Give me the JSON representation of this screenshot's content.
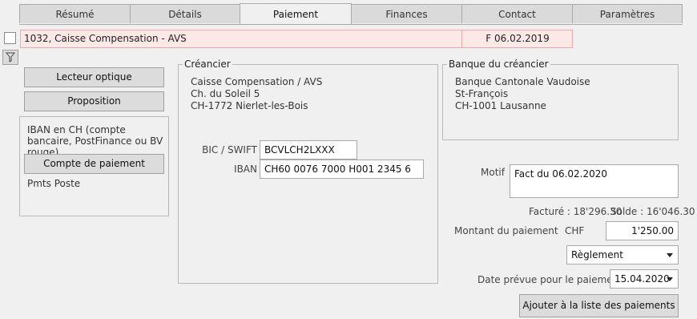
{
  "tabs": [
    "Résumé",
    "Détails",
    "Paiement",
    "Finances",
    "Contact",
    "Paramètres"
  ],
  "active_tab": "Paiement",
  "record": {
    "name": "1032, Caisse Compensation - AVS",
    "invoice": "F 06.02.2019"
  },
  "left": {
    "scanner_label": "Lecteur optique",
    "proposal_label": "Proposition",
    "account_type_text": "IBAN en CH (compte bancaire, PostFinance ou BV rouge)",
    "payment_account_label": "Compte de paiement",
    "pmts_text": "Pmts Poste"
  },
  "creditor": {
    "title": "Créancier",
    "address": [
      "Caisse Compensation / AVS",
      "Ch. du Soleil 5",
      "CH-1772 Nierlet-les-Bois"
    ],
    "bic_label": "BIC / SWIFT",
    "bic_value": "BCVLCH2LXXX",
    "iban_label": "IBAN",
    "iban_value": "CH60 0076 7000 H001 2345 6"
  },
  "bank": {
    "title": "Banque du créancier",
    "address": [
      "Banque Cantonale Vaudoise",
      "St-François",
      "CH-1001 Lausanne"
    ]
  },
  "payment": {
    "motif_label": "Motif",
    "motif_value": "Fact du 06.02.2020",
    "facture_text": "Facturé : 18'296.30",
    "solde_text": "Solde : 16'046.30",
    "amount_label": "Montant du paiement",
    "currency": "CHF",
    "amount_value": "1'250.00",
    "type_value": "Règlement",
    "date_label": "Date prévue pour le paiement",
    "date_value": "15.04.2020",
    "add_button_label": "Ajouter à la liste des paiements"
  },
  "icons": {
    "filter": "filter-icon",
    "dropdown": "chevron-down-icon"
  },
  "colors": {
    "record_bg": "#fde8e8",
    "record_border": "#f0a7a7",
    "background": "#f0f0f0"
  }
}
